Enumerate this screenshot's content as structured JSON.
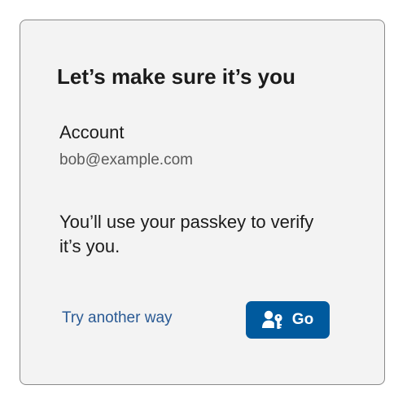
{
  "dialog": {
    "title": "Let’s make sure it’s you",
    "account_label": "Account",
    "account_email": "bob@example.com",
    "message": "You’ll use your passkey to verify it’s you.",
    "alternate_link": "Try another way",
    "go_button": {
      "label": "Go",
      "icon": "passkey-person-key-icon"
    }
  },
  "colors": {
    "card_background": "#f3f3f3",
    "card_border": "#8a8a8a",
    "accent": "#005a9e",
    "link": "#2a5a94",
    "secondary_text": "#5a5a5a"
  }
}
